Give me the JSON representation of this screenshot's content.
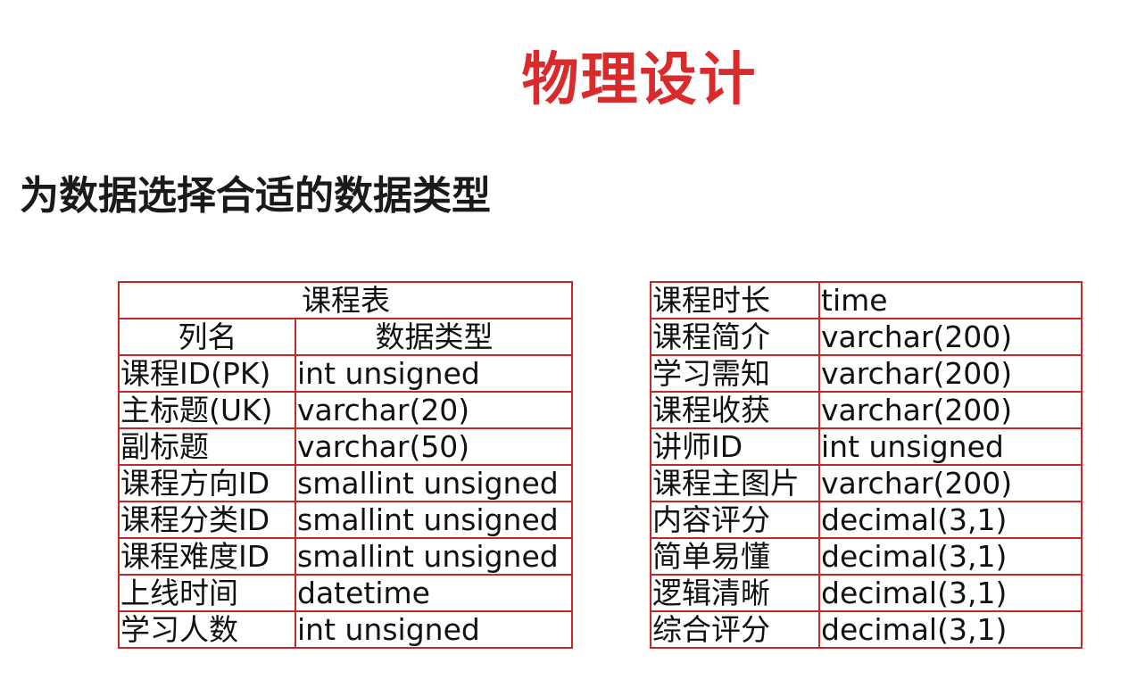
{
  "title": "物理设计",
  "subtitle": "为数据选择合适的数据类型",
  "left_table": {
    "caption": "课程表",
    "headers": [
      "列名",
      "数据类型"
    ],
    "rows": [
      [
        "课程ID(PK)",
        "int unsigned"
      ],
      [
        "主标题(UK)",
        "varchar(20)"
      ],
      [
        "副标题",
        "varchar(50)"
      ],
      [
        "课程方向ID",
        "smallint unsigned"
      ],
      [
        "课程分类ID",
        "smallint unsigned"
      ],
      [
        "课程难度ID",
        "smallint unsigned"
      ],
      [
        "上线时间",
        "datetime"
      ],
      [
        "学习人数",
        "int unsigned"
      ]
    ]
  },
  "right_table": {
    "rows": [
      [
        "课程时长",
        "time"
      ],
      [
        "课程简介",
        "varchar(200)"
      ],
      [
        "学习需知",
        "varchar(200)"
      ],
      [
        "课程收获",
        "varchar(200)"
      ],
      [
        "讲师ID",
        "int unsigned"
      ],
      [
        "课程主图片",
        "varchar(200)"
      ],
      [
        "内容评分",
        "decimal(3,1)"
      ],
      [
        "简单易懂",
        "decimal(3,1)"
      ],
      [
        "逻辑清晰",
        "decimal(3,1)"
      ],
      [
        "综合评分",
        "decimal(3,1)"
      ]
    ]
  },
  "colors": {
    "title": "#d92b2b",
    "table_border": "#c62828",
    "text": "#111111"
  }
}
